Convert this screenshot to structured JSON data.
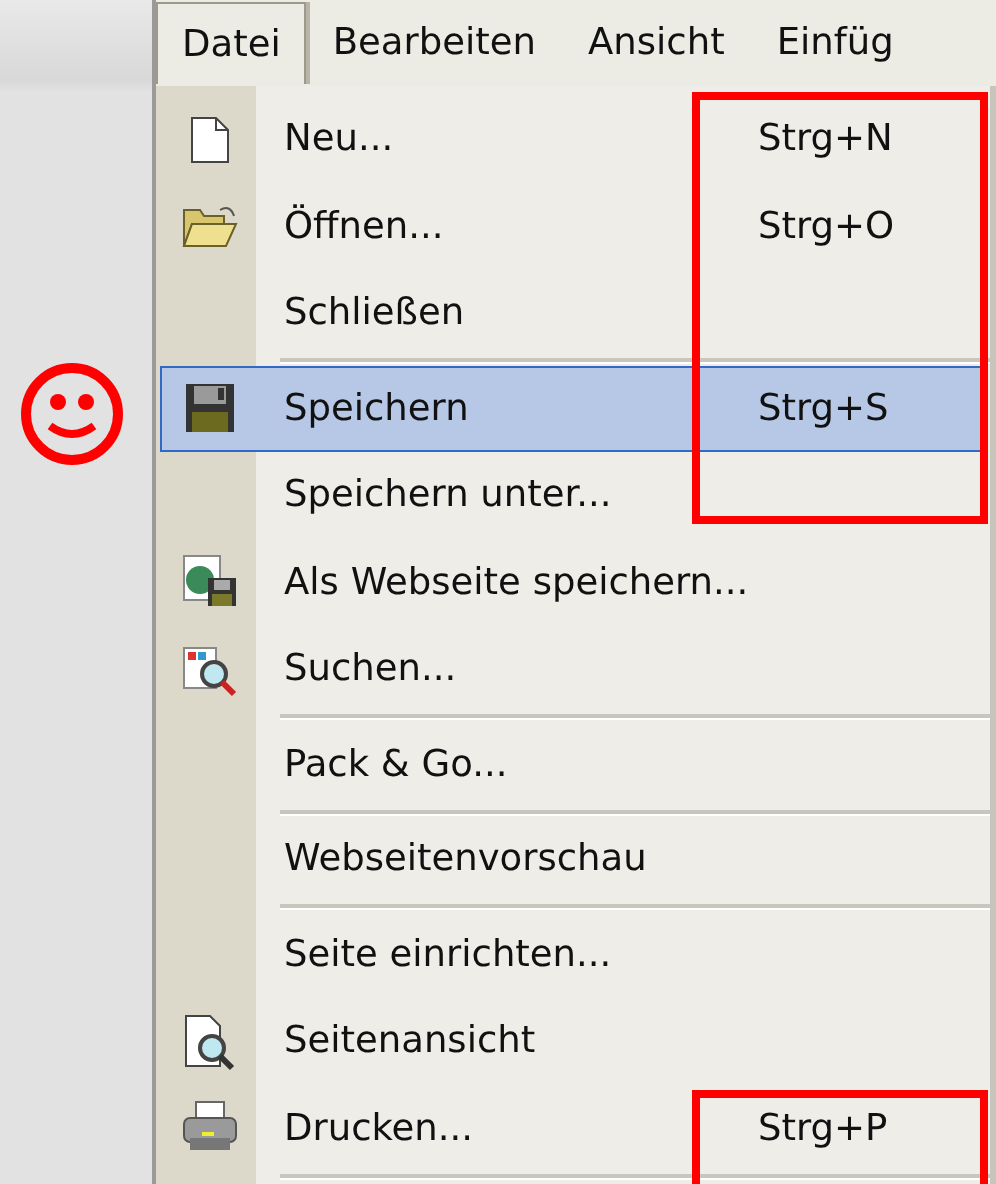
{
  "menubar": [
    {
      "label": "Datei",
      "selected": true
    },
    {
      "label": "Bearbeiten",
      "selected": false
    },
    {
      "label": "Ansicht",
      "selected": false
    },
    {
      "label": "Einfüg",
      "selected": false
    }
  ],
  "menu": [
    {
      "kind": "item",
      "label": "Neu...",
      "shortcut": "Strg+N",
      "selected": false
    },
    {
      "kind": "item",
      "label": "Öffnen...",
      "shortcut": "Strg+O",
      "selected": false
    },
    {
      "kind": "item",
      "label": "Schließen",
      "selected": false
    },
    {
      "kind": "separator"
    },
    {
      "kind": "item",
      "label": "Speichern",
      "shortcut": "Strg+S",
      "selected": true
    },
    {
      "kind": "item",
      "label": "Speichern unter...",
      "selected": false
    },
    {
      "kind": "item",
      "label": "Als Webseite speichern...",
      "selected": false
    },
    {
      "kind": "item",
      "label": "Suchen...",
      "selected": false
    },
    {
      "kind": "separator"
    },
    {
      "kind": "item",
      "label": "Pack & Go...",
      "selected": false
    },
    {
      "kind": "separator"
    },
    {
      "kind": "item",
      "label": "Webseitenvorschau",
      "selected": false
    },
    {
      "kind": "separator"
    },
    {
      "kind": "item",
      "label": "Seite einrichten...",
      "selected": false
    },
    {
      "kind": "item",
      "label": "Seitenansicht",
      "selected": false
    },
    {
      "kind": "item",
      "label": "Drucken...",
      "shortcut": "Strg+P",
      "selected": false
    },
    {
      "kind": "separator"
    }
  ]
}
